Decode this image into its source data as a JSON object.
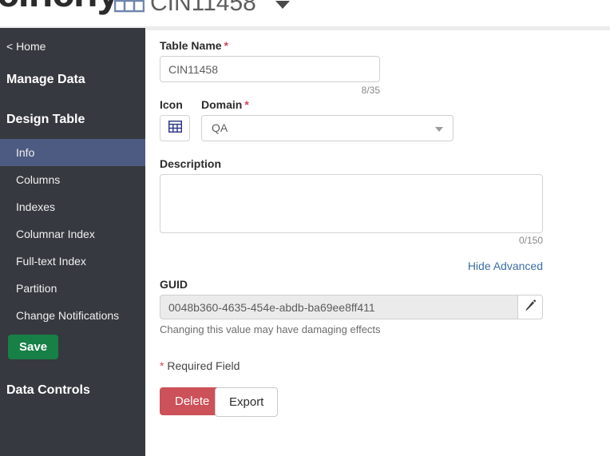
{
  "header": {
    "logo_text": "cinchy",
    "table_icon": "table-icon",
    "title": "CIN11458",
    "caret_icon": "chevron-down-icon"
  },
  "sidebar": {
    "home_label": "< Home",
    "sections": [
      {
        "label": "Manage Data"
      },
      {
        "label": "Design Table"
      },
      {
        "label": "Data Controls"
      }
    ],
    "items": [
      {
        "label": "Info",
        "selected": true
      },
      {
        "label": "Columns",
        "selected": false
      },
      {
        "label": "Indexes",
        "selected": false
      },
      {
        "label": "Columnar Index",
        "selected": false
      },
      {
        "label": "Full-text Index",
        "selected": false
      },
      {
        "label": "Partition",
        "selected": false
      },
      {
        "label": "Change Notifications",
        "selected": false
      }
    ],
    "save_label": "Save"
  },
  "form": {
    "table_name_label": "Table Name",
    "table_name_value": "CIN11458",
    "table_name_counter": "8/35",
    "icon_label": "Icon",
    "icon_glyph": "table-icon",
    "domain_label": "Domain",
    "domain_value": "QA",
    "description_label": "Description",
    "description_value": "",
    "description_counter": "0/150",
    "hide_advanced_label": "Hide Advanced",
    "guid_label": "GUID",
    "guid_value": "0048b360-4635-454e-abdb-ba69ee8ff411",
    "guid_edit_icon": "pencil-icon",
    "guid_note": "Changing this value may have damaging effects",
    "required_star": "*",
    "required_note": " Required Field",
    "delete_label": "Delete",
    "export_label": "Export"
  },
  "colors": {
    "sidebar_bg": "#36393f",
    "sidebar_selected": "#4d5b82",
    "save_green": "#178046",
    "delete_red": "#cc5159",
    "link_blue": "#3b6ea5",
    "required_red": "#d9415f"
  }
}
